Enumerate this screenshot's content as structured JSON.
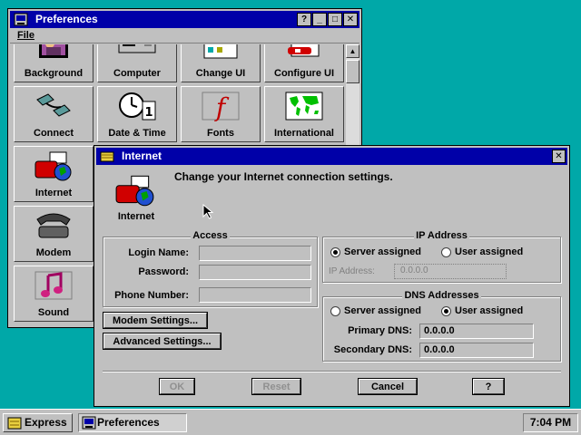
{
  "prefs_window": {
    "title": "Preferences",
    "menu": [
      "File"
    ],
    "tiles": [
      {
        "label": "Background"
      },
      {
        "label": "Computer"
      },
      {
        "label": "Change UI"
      },
      {
        "label": "Configure UI"
      },
      {
        "label": "Connect"
      },
      {
        "label": "Date & Time"
      },
      {
        "label": "Fonts"
      },
      {
        "label": "International"
      },
      {
        "label": "Internet"
      },
      {
        "label": "Modem"
      },
      {
        "label": "Sound"
      }
    ],
    "title_buttons": [
      "?",
      "_",
      "□",
      "✕"
    ]
  },
  "internet_dialog": {
    "title": "Internet",
    "icon_label": "Internet",
    "description": "Change your Internet connection settings.",
    "access": {
      "title": "Access",
      "login_label": "Login Name:",
      "password_label": "Password:",
      "phone_label": "Phone Number:"
    },
    "ip": {
      "title": "IP Address",
      "server_label": "Server assigned",
      "user_label": "User assigned",
      "selected": "server",
      "field_label": "IP Address:",
      "field_value": "0.0.0.0"
    },
    "dns": {
      "title": "DNS Addresses",
      "server_label": "Server assigned",
      "user_label": "User assigned",
      "selected": "user",
      "primary_label": "Primary DNS:",
      "primary_value": "0.0.0.0",
      "secondary_label": "Secondary DNS:",
      "secondary_value": "0.0.0.0"
    },
    "modem_settings": "Modem Settings...",
    "advanced_settings": "Advanced Settings...",
    "ok": "OK",
    "reset": "Reset",
    "cancel": "Cancel",
    "help": "?"
  },
  "taskbar": {
    "start_label": "Express",
    "task_label": "Preferences",
    "clock": "7:04 PM"
  },
  "colors": {
    "desktop": "#00a8a8",
    "titlebar": "#0000a8",
    "face": "#c0c0c0"
  }
}
